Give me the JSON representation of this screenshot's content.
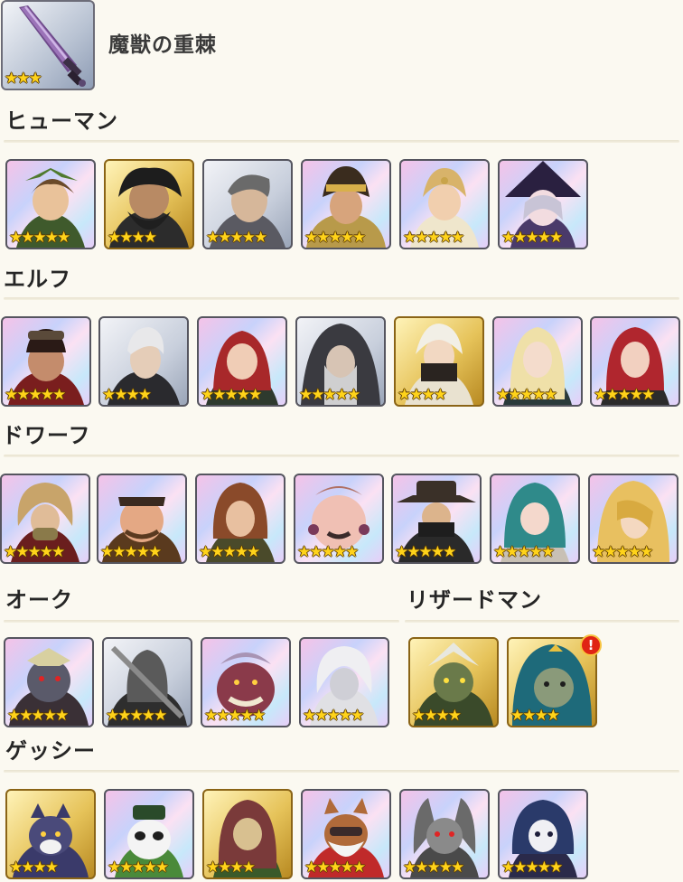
{
  "item": {
    "name": "魔獣の重棘",
    "stars": "★★★",
    "icon": "greatsword-icon"
  },
  "sections": {
    "human": {
      "title": "ヒューマン"
    },
    "elf": {
      "title": "エルフ"
    },
    "dwarf": {
      "title": "ドワーフ"
    },
    "orc": {
      "title": "オーク"
    },
    "lizardman": {
      "title": "リザードマン"
    },
    "gessie": {
      "title": "ゲッシー"
    }
  },
  "units": {
    "human": [
      "★★★★★",
      "★★★★",
      "★★★★★",
      "★★★★★",
      "★★★★★",
      "★★★★★"
    ],
    "elf": [
      "★★★★★",
      "★★★★",
      "★★★★★",
      "★★★★★",
      "★★★★",
      "★★★★★",
      "★★★★★"
    ],
    "dwarf": [
      "★★★★★",
      "★★★★★",
      "★★★★★",
      "★★★★★",
      "★★★★★",
      "★★★★★",
      "★★★★★"
    ],
    "orc": [
      "★★★★★",
      "★★★★★",
      "★★★★★",
      "★★★★★"
    ],
    "lizardman": [
      "★★★★",
      "★★★★"
    ],
    "gessie": [
      "★★★★",
      "★★★★★",
      "★★★★",
      "★★★★★",
      "★★★★★",
      "★★★★★"
    ]
  },
  "alert": {
    "symbol": "!"
  },
  "colors": {
    "background": "#fbf9f1",
    "star": "#ffd31a",
    "alert": "#e02414",
    "gold_frame": "#e6c35a"
  }
}
